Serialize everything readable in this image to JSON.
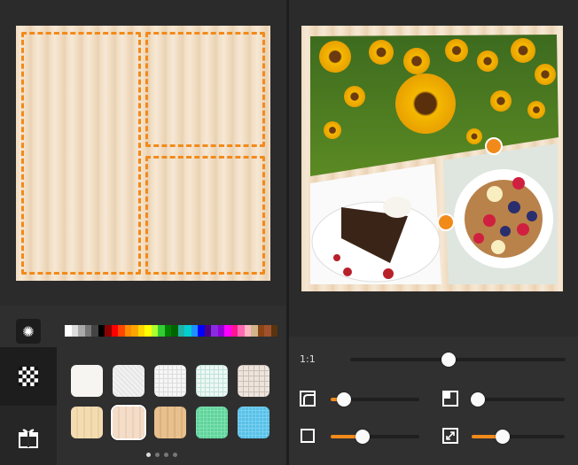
{
  "left_preview": {
    "cells": [
      "cell-left",
      "cell-top-right",
      "cell-bottom-right"
    ]
  },
  "palette": {
    "colors": [
      "#ffffff",
      "#dddddd",
      "#aaaaaa",
      "#777777",
      "#444444",
      "#000000",
      "#8b0000",
      "#ff0000",
      "#ff4500",
      "#ff8c00",
      "#ffa500",
      "#ffd700",
      "#ffff00",
      "#adff2f",
      "#32cd32",
      "#008000",
      "#006400",
      "#20b2aa",
      "#00ced1",
      "#1e90ff",
      "#0000ff",
      "#4b0082",
      "#8a2be2",
      "#9400d3",
      "#ff00ff",
      "#ff1493",
      "#ff69b4",
      "#ffb6c1",
      "#d2b48c",
      "#8b4513",
      "#a0522d",
      "#5a3310"
    ]
  },
  "tools": [
    {
      "name": "effect",
      "icon": "sparkle-icon"
    },
    {
      "name": "pattern",
      "icon": "checker-icon",
      "active": true
    },
    {
      "name": "gift",
      "icon": "gift-icon"
    }
  ],
  "backgrounds": {
    "row1": [
      "paper-white",
      "paper-light",
      "grid-white",
      "grid-mint",
      "grid-beige"
    ],
    "row2": [
      "wood-light",
      "wood-pink",
      "wood-tan",
      "grid-green",
      "grid-blue"
    ],
    "selected": 1,
    "page": 0,
    "page_count": 4
  },
  "controls": {
    "ratio_label": "1:1",
    "ratio_value": 0.45,
    "corner_radius": 0.08,
    "inner_margin": 0.05,
    "outer_margin": 0.27,
    "shadow": 0.33
  },
  "colors": {
    "accent": "#f28a1a",
    "bg": "#2b2b2b"
  }
}
